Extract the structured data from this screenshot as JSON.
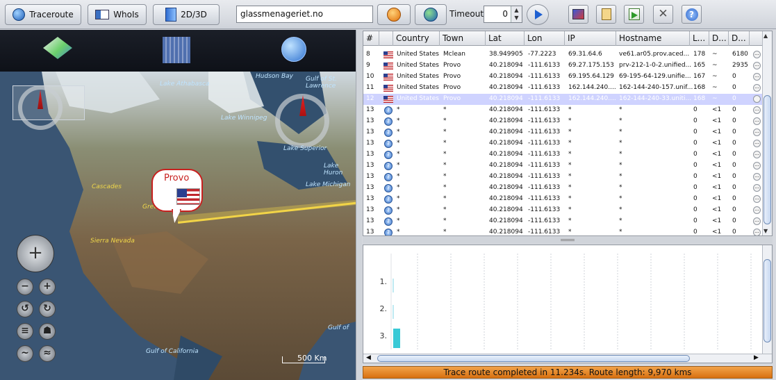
{
  "toolbar": {
    "traceroute_label": "Traceroute",
    "whois_label": "WhoIs",
    "view_label": "2D/3D",
    "url_value": "glassmenageriet.no",
    "timeout_label": "Timeout",
    "timeout_value": "0"
  },
  "map": {
    "balloon_label": "Provo",
    "scale_label": "500 Km",
    "places": {
      "lake_athabasca": "Lake Athabasca",
      "hudson_bay": "Hudson Bay",
      "gulf_st_lawrence": "Gulf of St. Lawrence",
      "lake_winnipeg": "Lake Winnipeg",
      "lake_superior": "Lake Superior",
      "lake_huron": "Lake Huron",
      "lake_michigan": "Lake Michigan",
      "cascades": "Cascades",
      "great": "Great",
      "sierra_nevada": "Sierra Nevada",
      "gulf_of_california": "Gulf of California",
      "gulf_of": "Gulf of"
    }
  },
  "table": {
    "headers": [
      "#",
      "",
      "Country",
      "Town",
      "Lat",
      "Lon",
      "IP",
      "Hostname",
      "L...",
      "D...",
      "D..."
    ],
    "rows": [
      {
        "n": "8",
        "flag": "us",
        "country": "United States",
        "town": "Mclean",
        "lat": "38.949905",
        "lon": "-77.2223",
        "ip": "69.31.64.6",
        "host": "ve61.ar05.prov.aced...",
        "l": "178",
        "d1": "~",
        "d2": "6180"
      },
      {
        "n": "9",
        "flag": "us",
        "country": "United States",
        "town": "Provo",
        "lat": "40.218094",
        "lon": "-111.6133",
        "ip": "69.27.175.153",
        "host": "prv-212-1-0-2.unified...",
        "l": "165",
        "d1": "~",
        "d2": "2935"
      },
      {
        "n": "10",
        "flag": "us",
        "country": "United States",
        "town": "Provo",
        "lat": "40.218094",
        "lon": "-111.6133",
        "ip": "69.195.64.129",
        "host": "69-195-64-129.unifie...",
        "l": "167",
        "d1": "~",
        "d2": "0"
      },
      {
        "n": "11",
        "flag": "us",
        "country": "United States",
        "town": "Provo",
        "lat": "40.218094",
        "lon": "-111.6133",
        "ip": "162.144.240....",
        "host": "162-144-240-157.unif...",
        "l": "168",
        "d1": "~",
        "d2": "0"
      },
      {
        "n": "12",
        "flag": "us",
        "country": "United States",
        "town": "Provo",
        "lat": "40.218094",
        "lon": "-111.6133",
        "ip": "162.144.240....",
        "host": "162-144-240-33.uniti...",
        "l": "168",
        "d1": "~",
        "d2": "0",
        "selected": true
      },
      {
        "n": "13",
        "flag": "q",
        "country": "*",
        "town": "*",
        "lat": "40.218094",
        "lon": "-111.6133",
        "ip": "*",
        "host": "*",
        "l": "0",
        "d1": "<1",
        "d2": "0"
      },
      {
        "n": "13",
        "flag": "q",
        "country": "*",
        "town": "*",
        "lat": "40.218094",
        "lon": "-111.6133",
        "ip": "*",
        "host": "*",
        "l": "0",
        "d1": "<1",
        "d2": "0"
      },
      {
        "n": "13",
        "flag": "q",
        "country": "*",
        "town": "*",
        "lat": "40.218094",
        "lon": "-111.6133",
        "ip": "*",
        "host": "*",
        "l": "0",
        "d1": "<1",
        "d2": "0"
      },
      {
        "n": "13",
        "flag": "q",
        "country": "*",
        "town": "*",
        "lat": "40.218094",
        "lon": "-111.6133",
        "ip": "*",
        "host": "*",
        "l": "0",
        "d1": "<1",
        "d2": "0"
      },
      {
        "n": "13",
        "flag": "q",
        "country": "*",
        "town": "*",
        "lat": "40.218094",
        "lon": "-111.6133",
        "ip": "*",
        "host": "*",
        "l": "0",
        "d1": "<1",
        "d2": "0"
      },
      {
        "n": "13",
        "flag": "q",
        "country": "*",
        "town": "*",
        "lat": "40.218094",
        "lon": "-111.6133",
        "ip": "*",
        "host": "*",
        "l": "0",
        "d1": "<1",
        "d2": "0"
      },
      {
        "n": "13",
        "flag": "q",
        "country": "*",
        "town": "*",
        "lat": "40.218094",
        "lon": "-111.6133",
        "ip": "*",
        "host": "*",
        "l": "0",
        "d1": "<1",
        "d2": "0"
      },
      {
        "n": "13",
        "flag": "q",
        "country": "*",
        "town": "*",
        "lat": "40.218094",
        "lon": "-111.6133",
        "ip": "*",
        "host": "*",
        "l": "0",
        "d1": "<1",
        "d2": "0"
      },
      {
        "n": "13",
        "flag": "q",
        "country": "*",
        "town": "*",
        "lat": "40.218094",
        "lon": "-111.6133",
        "ip": "*",
        "host": "*",
        "l": "0",
        "d1": "<1",
        "d2": "0"
      },
      {
        "n": "13",
        "flag": "q",
        "country": "*",
        "town": "*",
        "lat": "40.218094",
        "lon": "-111.6133",
        "ip": "*",
        "host": "*",
        "l": "0",
        "d1": "<1",
        "d2": "0"
      },
      {
        "n": "13",
        "flag": "q",
        "country": "*",
        "town": "*",
        "lat": "40.218094",
        "lon": "-111.6133",
        "ip": "*",
        "host": "*",
        "l": "0",
        "d1": "<1",
        "d2": "0"
      },
      {
        "n": "13",
        "flag": "q",
        "country": "*",
        "town": "*",
        "lat": "40.218094",
        "lon": "-111.6133",
        "ip": "*",
        "host": "*",
        "l": "0",
        "d1": "<1",
        "d2": "0"
      }
    ]
  },
  "latency_chart": {
    "row_labels": [
      "1.",
      "2.",
      "3."
    ]
  },
  "status": {
    "text": "Trace route completed in 11.234s. Route length: 9,970 kms"
  },
  "colors": {
    "status_bg": "#e8891f",
    "route_line": "#f2d447",
    "selected_row": "#cfd3ff"
  }
}
